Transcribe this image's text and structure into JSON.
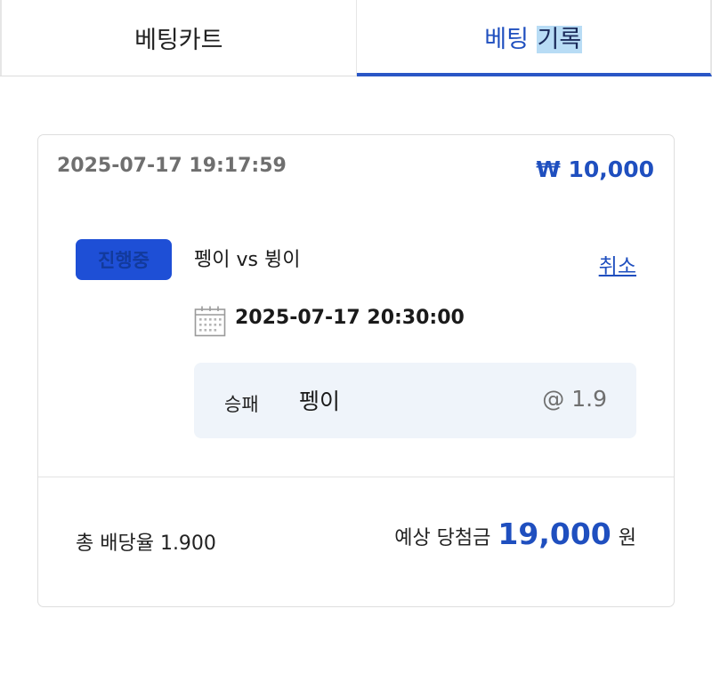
{
  "tabs": {
    "cart_label": "베팅카트",
    "history_label_part1": "베팅 ",
    "history_label_part2": "기록",
    "active": "history"
  },
  "bet": {
    "placed_at": "2025-07-17 19:17:59",
    "amount": "₩ 10,000",
    "status": "진행중",
    "match": "펭이 vs 뷩이",
    "cancel_label": "취소",
    "match_datetime": "2025-07-17 20:30:00",
    "market": "승패",
    "selection": "펭이",
    "odds": "@ 1.9"
  },
  "summary": {
    "total_odds": "총 배당율 1.900",
    "expected_label": "예상 당첨금",
    "expected_value": "19,000",
    "expected_unit": "원"
  },
  "colors": {
    "accent": "#1f4fbf",
    "badge": "#1e4fd6",
    "pick_bg": "#eff4fa"
  },
  "icons": {
    "calendar": "calendar-icon"
  }
}
